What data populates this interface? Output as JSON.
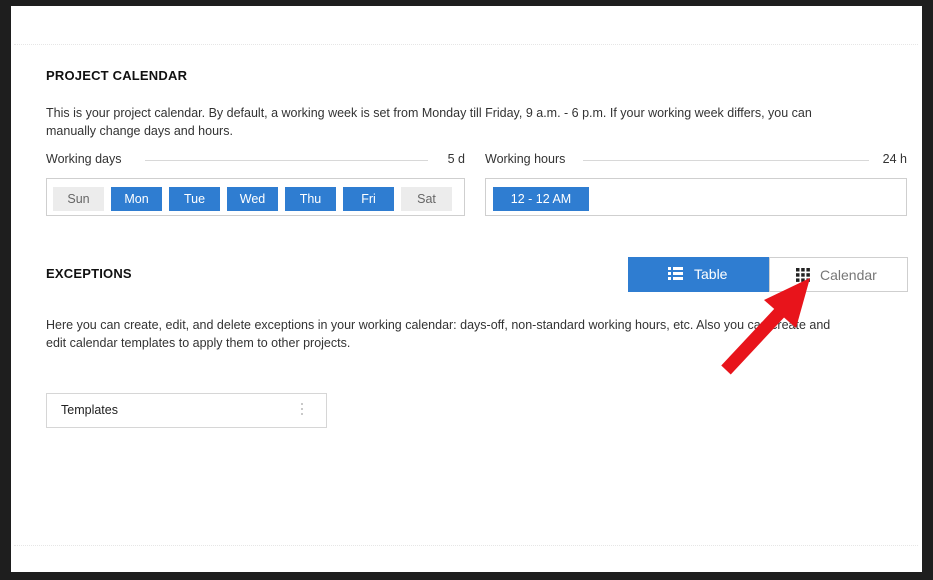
{
  "project_calendar": {
    "title": "PROJECT CALENDAR",
    "description_line1": "This is your project calendar. By default, a working week is set from Monday till Friday, 9 a.m. - 6 p.m. If your working week differs, you can",
    "description_line2": "manually change days and hours.",
    "working_days": {
      "label": "Working days",
      "count": "5 d",
      "days": [
        {
          "label": "Sun",
          "selected": false
        },
        {
          "label": "Mon",
          "selected": true
        },
        {
          "label": "Tue",
          "selected": true
        },
        {
          "label": "Wed",
          "selected": true
        },
        {
          "label": "Thu",
          "selected": true
        },
        {
          "label": "Fri",
          "selected": true
        },
        {
          "label": "Sat",
          "selected": false
        }
      ]
    },
    "working_hours": {
      "label": "Working hours",
      "count": "24 h",
      "range": "12 - 12 AM"
    }
  },
  "exceptions": {
    "title": "EXCEPTIONS",
    "view_toggle": {
      "table_label": "Table",
      "table_icon": "list-icon",
      "calendar_label": "Calendar",
      "calendar_icon": "grid-icon",
      "active": "Table"
    },
    "description_line1": "Here you can create, edit, and delete exceptions in your working calendar: days-off, non-standard working hours, etc. Also you can create and",
    "description_line2": "edit calendar templates to apply them to other projects.",
    "templates_label": "Templates"
  },
  "colors": {
    "accent": "#2f7dd1",
    "inactive_day": "#ececec",
    "annotation_arrow": "#e8141b"
  }
}
